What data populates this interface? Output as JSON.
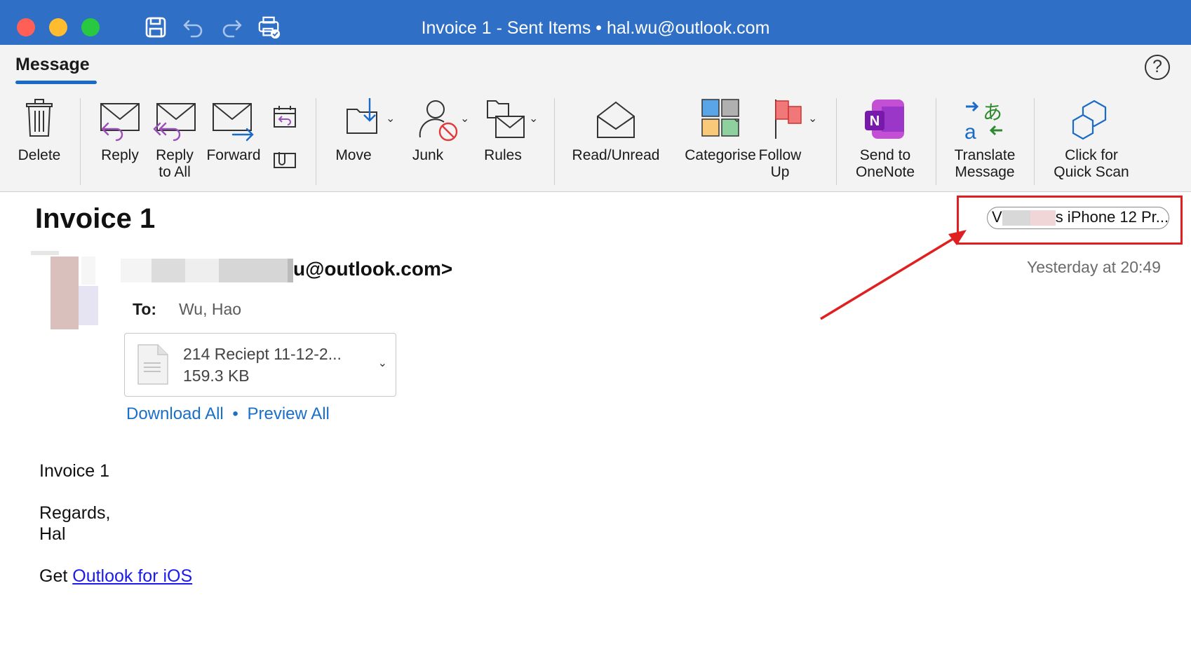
{
  "window": {
    "title": "Invoice 1 - Sent Items • hal.wu@outlook.com"
  },
  "ribbon": {
    "tab": "Message",
    "buttons": {
      "delete": "Delete",
      "reply": "Reply",
      "reply_all_1": "Reply",
      "reply_all_2": "to All",
      "forward": "Forward",
      "move": "Move",
      "junk": "Junk",
      "rules": "Rules",
      "read_unread": "Read/Unread",
      "categorise": "Categorise",
      "follow_up_1": "Follow",
      "follow_up_2": "Up",
      "onenote_1": "Send to",
      "onenote_2": "OneNote",
      "translate_1": "Translate",
      "translate_2": "Message",
      "quickscan_1": "Click for",
      "quickscan_2": "Quick Scan"
    },
    "help": "?"
  },
  "message": {
    "subject": "Invoice 1",
    "device": {
      "prefix": "V",
      "suffix": "s iPhone 12 Pr..."
    },
    "date": "Yesterday at 20:49",
    "sender_suffix": "u@outlook.com>",
    "to_label": "To:",
    "to_value": "Wu, Hao",
    "attachment": {
      "name": "214 Reciept 11-12-2...",
      "size": "159.3 KB"
    },
    "download_all": "Download All",
    "dot": "•",
    "preview_all": "Preview All",
    "body": {
      "line1": "Invoice 1",
      "line2": "Regards,",
      "line3": "Hal",
      "get": "Get ",
      "link": "Outlook for iOS"
    }
  }
}
